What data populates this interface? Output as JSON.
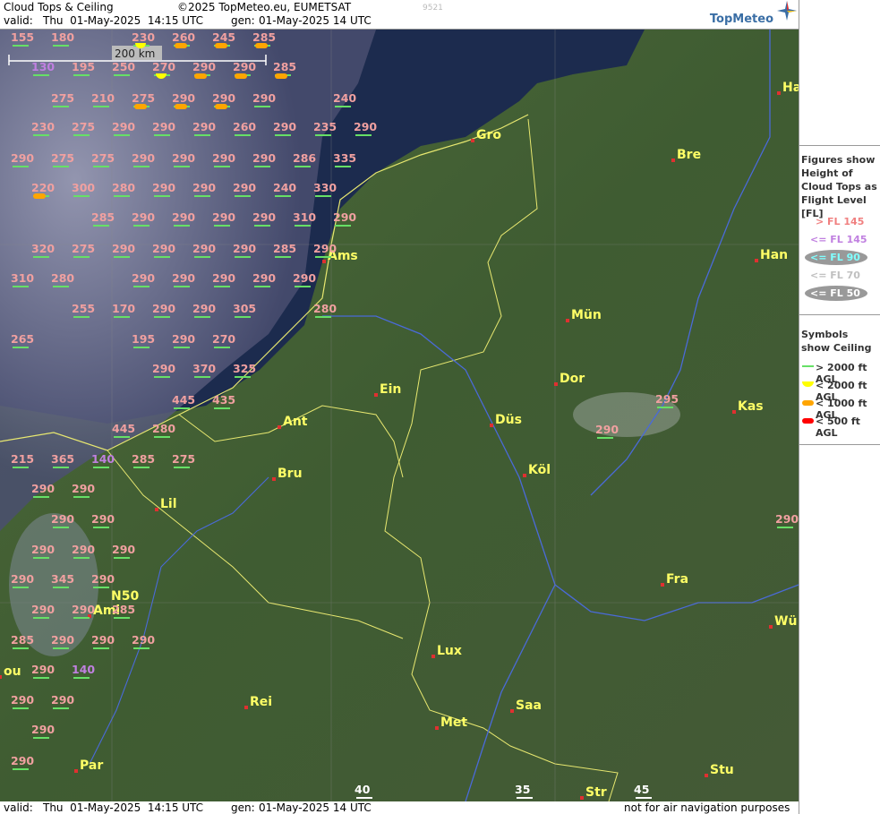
{
  "header": {
    "title": "Cloud Tops & Ceiling",
    "copyright": "©2025 TopMeteo.eu, EUMETSAT",
    "code": "9521",
    "valid_label": "valid:",
    "valid_value": "Thu  01-May-2025  14:15 UTC",
    "gen_label": "gen:",
    "gen_value": "01-May-2025 14 UTC",
    "logo": "TopMeteo"
  },
  "footer": {
    "valid_label": "valid:",
    "valid_value": "Thu  01-May-2025  14:15 UTC",
    "gen_label": "gen:",
    "gen_value": "01-May-2025 14 UTC",
    "disclaimer": "not for air navigation purposes"
  },
  "legend": {
    "figures_title": "Figures show Height of Cloud Tops as Flight Level  [FL]",
    "fl_items": [
      {
        "label": "> FL 145",
        "color": "#f08080"
      },
      {
        "label": "<= FL 145",
        "color": "#c080e0"
      },
      {
        "label": "<= FL 90",
        "color": "#80ffff"
      },
      {
        "label": "<= FL 70",
        "color": "#c0c0c0"
      },
      {
        "label": "<= FL 50",
        "color": "#ffffff"
      }
    ],
    "symbols_title": "Symbols show Ceiling",
    "sym_items": [
      {
        "label": "> 2000 ft AGL",
        "color": "#66e066"
      },
      {
        "label": "< 2000 ft AGL",
        "color": "#ffff00"
      },
      {
        "label": "< 1000 ft AGL",
        "color": "#ffa500"
      },
      {
        "label": "< 500 ft AGL",
        "color": "#ff0000"
      }
    ]
  },
  "scale_label": "200 km",
  "lat_label": "N50",
  "cities": [
    {
      "name": "Gro"
    },
    {
      "name": "Bre"
    },
    {
      "name": "Ha"
    },
    {
      "name": "Ams"
    },
    {
      "name": "Han"
    },
    {
      "name": "Mün"
    },
    {
      "name": "Dor"
    },
    {
      "name": "Ein"
    },
    {
      "name": "Kas"
    },
    {
      "name": "Ant"
    },
    {
      "name": "Düs"
    },
    {
      "name": "Köl"
    },
    {
      "name": "Bru"
    },
    {
      "name": "Lil"
    },
    {
      "name": "Fra"
    },
    {
      "name": "Ami"
    },
    {
      "name": "Wü"
    },
    {
      "name": "Lux"
    },
    {
      "name": "Rei"
    },
    {
      "name": "Saa"
    },
    {
      "name": "Met"
    },
    {
      "name": "Stu"
    },
    {
      "name": "Par"
    },
    {
      "name": "Str"
    },
    {
      "name": "ou"
    }
  ],
  "fl_values": [
    "155",
    "180",
    "230",
    "260",
    "245",
    "285",
    "130",
    "195",
    "250",
    "270",
    "290",
    "290",
    "285",
    "275",
    "210",
    "275",
    "290",
    "290",
    "290",
    "240",
    "230",
    "275",
    "290",
    "290",
    "290",
    "260",
    "290",
    "235",
    "290",
    "290",
    "275",
    "275",
    "290",
    "290",
    "290",
    "290",
    "286",
    "335",
    "220",
    "300",
    "280",
    "290",
    "290",
    "290",
    "240",
    "330",
    "285",
    "290",
    "290",
    "290",
    "290",
    "310",
    "290",
    "320",
    "275",
    "290",
    "290",
    "290",
    "290",
    "285",
    "290",
    "310",
    "280",
    "290",
    "290",
    "290",
    "290",
    "290",
    "255",
    "170",
    "290",
    "290",
    "305",
    "280",
    "265",
    "195",
    "290",
    "270",
    "290",
    "370",
    "325",
    "445",
    "435",
    "445",
    "280",
    "215",
    "365",
    "140",
    "285",
    "275",
    "290",
    "290",
    "290",
    "290",
    "290",
    "290",
    "290",
    "290",
    "345",
    "290",
    "290",
    "290",
    "285",
    "285",
    "290",
    "290",
    "290",
    "290",
    "140",
    "290",
    "290",
    "290",
    "290",
    "295",
    "290",
    "290",
    "40",
    "35",
    "45",
    "35",
    "45",
    "45"
  ]
}
